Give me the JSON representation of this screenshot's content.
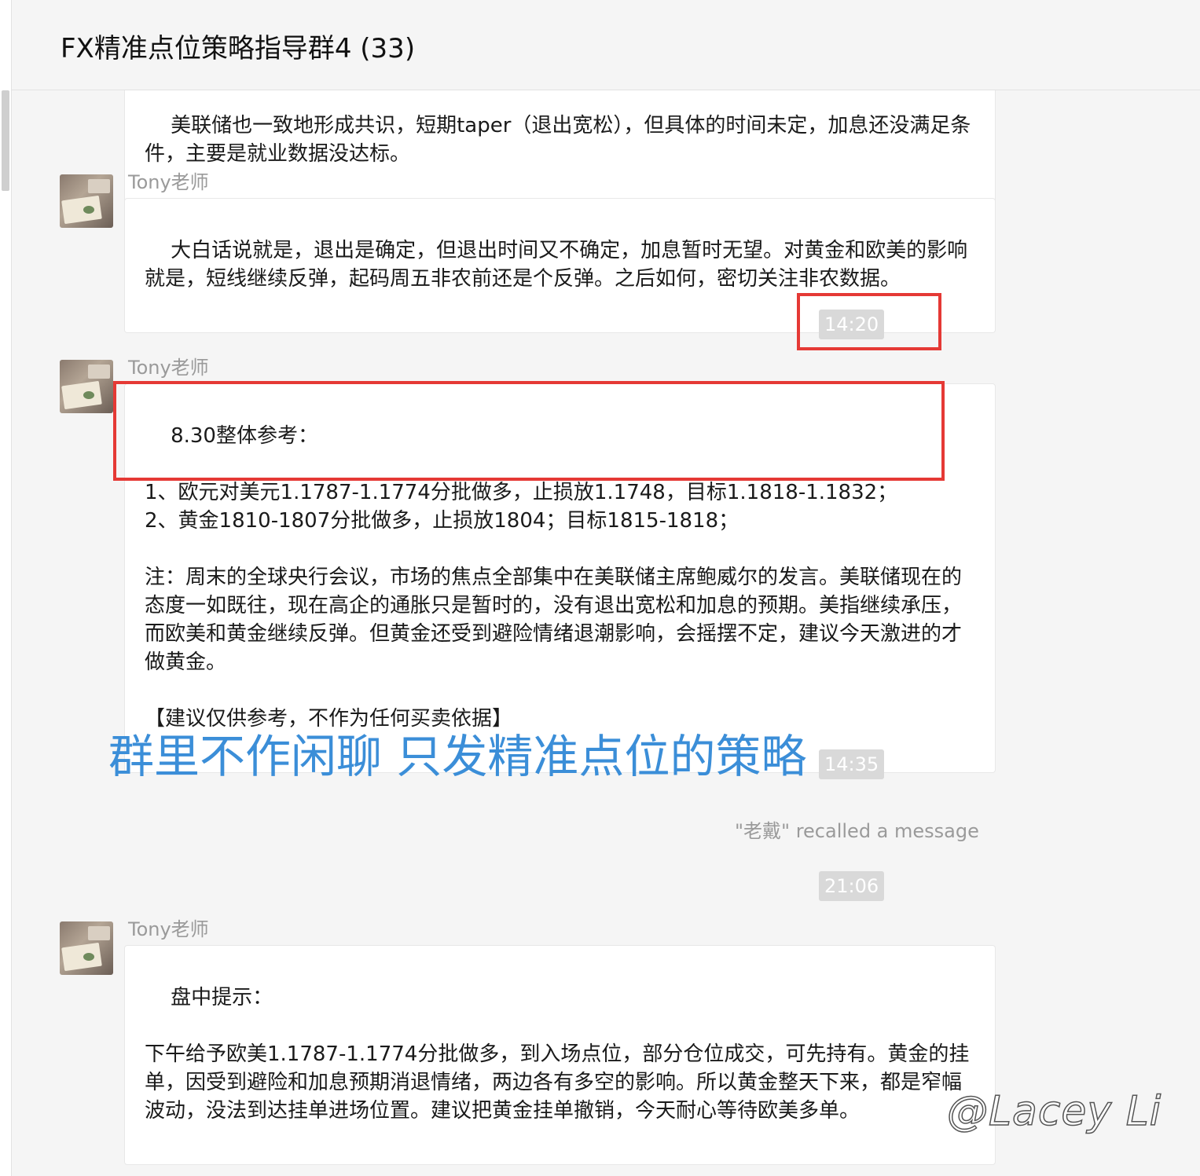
{
  "header": {
    "title": "FX精准点位策略指导群4 (33)"
  },
  "messages": {
    "m0": {
      "text": "美联储也一致地形成共识，短期taper（退出宽松），但具体的时间未定，加息还没满足条件，主要是就业数据没达标。"
    },
    "m1": {
      "sender": "Tony老师",
      "text": "大白话说就是，退出是确定，但退出时间又不确定，加息暂时无望。对黄金和欧美的影响就是，短线继续反弹，起码周五非农前还是个反弹。之后如何，密切关注非农数据。"
    },
    "time1": "14:20",
    "m2": {
      "sender": "Tony老师",
      "text": "8.30整体参考：\n\n1、欧元对美元1.1787-1.1774分批做多，止损放1.1748，目标1.1818-1.1832；\n2、黄金1810-1807分批做多，止损放1804；目标1815-1818；\n\n注：周末的全球央行会议，市场的焦点全部集中在美联储主席鲍威尔的发言。美联储现在的态度一如既往，现在高企的通胀只是暂时的，没有退出宽松和加息的预期。美指继续承压，而欧美和黄金继续反弹。但黄金还受到避险情绪退潮影响，会摇摆不定，建议今天激进的才做黄金。\n\n【建议仅供参考，不作为任何买卖依据】"
    },
    "time2": "14:35",
    "recalled": "\"老戴\" recalled a message",
    "time3": "21:06",
    "m3": {
      "sender": "Tony老师",
      "text": "盘中提示：\n\n下午给予欧美1.1787-1.1774分批做多，到入场点位，部分仓位成交，可先持有。黄金的挂单，因受到避险和加息预期消退情绪，两边各有多空的影响。所以黄金整天下来，都是窄幅波动，没法到达挂单进场位置。建议把黄金挂单撤销，今天耐心等待欧美多单。"
    }
  },
  "overlay_text": "群里不作闲聊 只发精准点位的策略",
  "watermark": "@Lacey Li",
  "colors": {
    "highlight_box": "#e53935",
    "overlay_text": "#3b8ed8",
    "time_chip": "#d9d9d9"
  }
}
